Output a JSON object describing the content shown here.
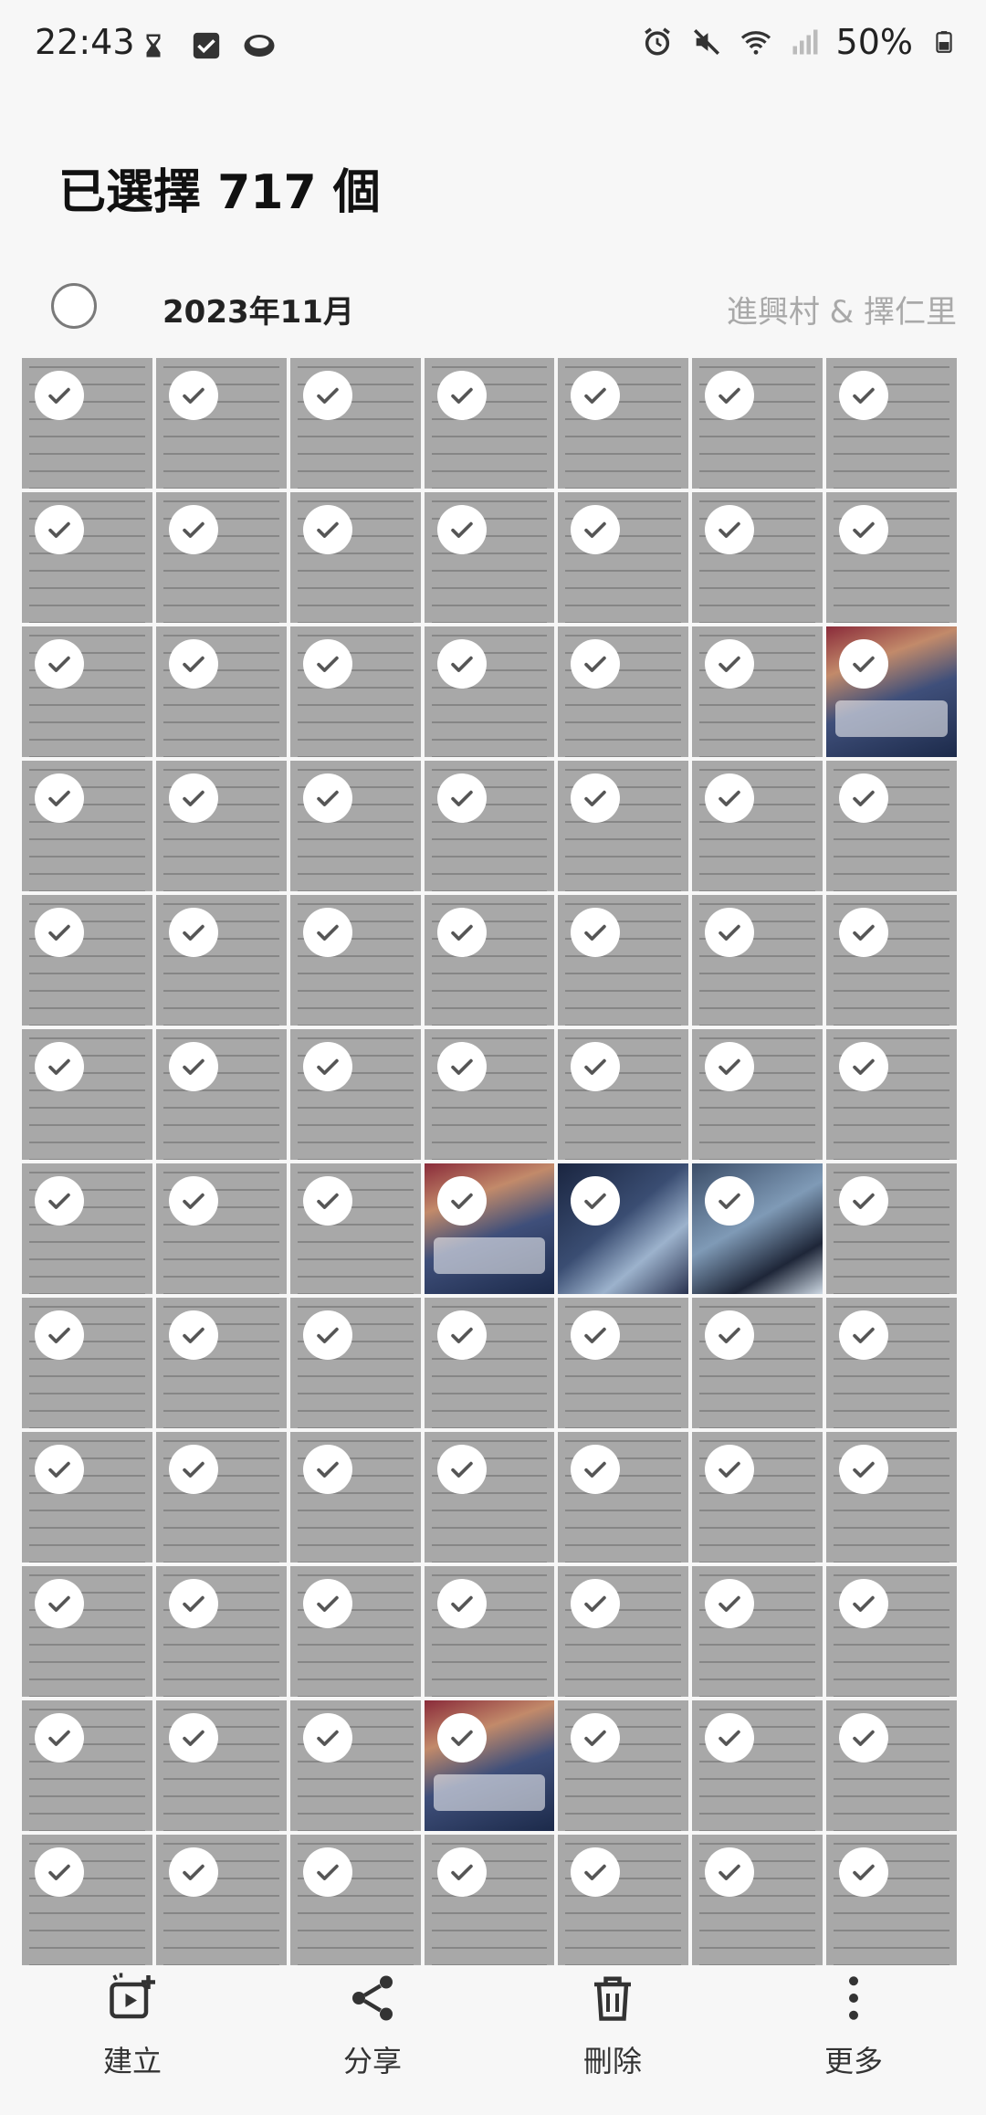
{
  "status_bar": {
    "time": "22:43",
    "battery": "50%",
    "left_icons": [
      "hourglass-icon",
      "checkbox-icon",
      "cloud-app-icon"
    ],
    "right_icons": [
      "alarm-icon",
      "mute-icon",
      "wifi-icon",
      "signal-icon",
      "battery-icon"
    ]
  },
  "header": {
    "title": "已選擇 717 個"
  },
  "section": {
    "date": "2023年11月",
    "location": "進興村 & 擇仁里"
  },
  "grid": {
    "columns": 7,
    "selected_check_color": "#555555",
    "tiles": [
      "page",
      "page",
      "page",
      "page",
      "page",
      "page",
      "page",
      "page",
      "page",
      "page",
      "page",
      "page",
      "page",
      "page",
      "page",
      "page",
      "page",
      "page",
      "page",
      "page",
      "cover-a",
      "page",
      "page",
      "page",
      "page",
      "page",
      "page",
      "page",
      "page",
      "page",
      "page",
      "page",
      "page",
      "page",
      "page",
      "page",
      "page",
      "page",
      "page",
      "page",
      "page",
      "page",
      "page",
      "page",
      "page",
      "cover-a",
      "dark-a",
      "dark-b",
      "page",
      "page",
      "page",
      "page",
      "page",
      "page",
      "page",
      "page",
      "page",
      "page",
      "page",
      "page",
      "page",
      "page",
      "page",
      "page",
      "page",
      "page",
      "page",
      "page",
      "page",
      "page",
      "page",
      "page",
      "page",
      "cover-a",
      "page",
      "page",
      "page",
      "page",
      "page",
      "page",
      "page",
      "page",
      "page",
      "page"
    ]
  },
  "bottom_bar": {
    "create_label": "建立",
    "share_label": "分享",
    "delete_label": "刪除",
    "more_label": "更多"
  }
}
